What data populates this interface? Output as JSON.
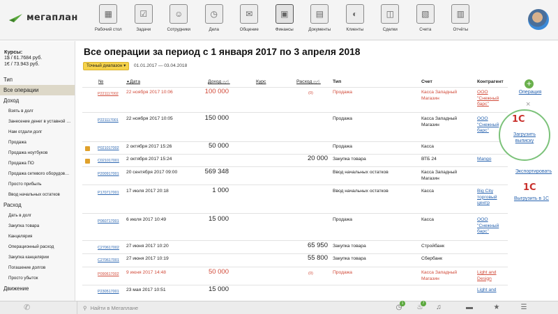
{
  "app": {
    "name": "мегаплан"
  },
  "nav": [
    {
      "label": "Рабочий стол",
      "icon": "desktop-icon"
    },
    {
      "label": "Задачи",
      "icon": "tasks-icon"
    },
    {
      "label": "Сотрудники",
      "icon": "employees-icon"
    },
    {
      "label": "Дела",
      "icon": "clock-icon"
    },
    {
      "label": "Общение",
      "icon": "chat-icon"
    },
    {
      "label": "Финансы",
      "icon": "safe-icon",
      "active": true
    },
    {
      "label": "Документы",
      "icon": "folder-icon"
    },
    {
      "label": "Клиенты",
      "icon": "clients-icon"
    },
    {
      "label": "Сделки",
      "icon": "briefcase-icon"
    },
    {
      "label": "Счета",
      "icon": "invoice-icon"
    },
    {
      "label": "Отчёты",
      "icon": "reports-icon"
    }
  ],
  "rates": {
    "title": "Курсы:",
    "usd": "1$ / 61.7684 руб.",
    "eur": "1€ / 73.943 руб."
  },
  "sidebar": {
    "type_head": "Тип",
    "all": "Все операции",
    "income_head": "Доход",
    "income": [
      "Взять в долг",
      "Занесение денег в уставной …",
      "Нам отдали долг",
      "Продажа",
      "Продажа ноутбуков",
      "Продажа ПО",
      "Продажа сетевого оборудов…",
      "Просто прибыль",
      "Ввод начальных остатков"
    ],
    "expense_head": "Расход",
    "expense": [
      "Дать в долг",
      "Закупка товара",
      "Канцелярия",
      "Операционный расход",
      "Закупка канцелярии",
      "Погашение долгов",
      "Просто убыток"
    ],
    "move_head": "Движение"
  },
  "main": {
    "title": "Все операции за период с 1 января 2017 по 3 апреля 2018",
    "range_label": "Точный диапазон",
    "range_value": "01.01.2017 — 03.04.2018"
  },
  "columns": {
    "num": "№",
    "date": "Дата",
    "income": "Доход",
    "unit1": "руб.",
    "rate": "Курс",
    "expense": "Расход",
    "unit2": "руб.",
    "type": "Тип",
    "account": "Счет",
    "contractor": "Контрагент"
  },
  "rows": [
    {
      "code": "Р221117002",
      "date": "22 ноября 2017 10:06",
      "income": "100 000",
      "expense": "(0)",
      "type": "Продажа",
      "account": "Касса Западный Магазин",
      "contractor": "ООО \"Снежный барс\"",
      "red": true
    },
    {
      "code": "Р221117001",
      "date": "22 ноября 2017 10:05",
      "income": "150 000",
      "expense": "",
      "type": "Продажа",
      "account": "Касса Западный Магазин",
      "contractor": "ООО \"Снежный барс\"",
      "red": false
    },
    {
      "code": "Р021017002",
      "date": "2 октября 2017 15:26",
      "income": "50 000",
      "expense": "",
      "type": "Продажа",
      "account": "Касса",
      "contractor": "",
      "red": false,
      "warn": true
    },
    {
      "code": "С021017001",
      "date": "2 октября 2017 15:24",
      "income": "",
      "expense": "20 000",
      "type": "Закупка товара",
      "account": "ВТБ 24",
      "contractor": "Mango",
      "red": false,
      "warn": true
    },
    {
      "code": "Р200917001",
      "date": "20 сентября 2017 09:00",
      "income": "569 348",
      "expense": "",
      "type": "Ввод начальных остатков",
      "account": "Касса Западный Магазин",
      "contractor": "",
      "red": false
    },
    {
      "code": "Р170717001",
      "date": "17 июля 2017 20:18",
      "income": "1 000",
      "expense": "",
      "type": "Ввод начальных остатков",
      "account": "Касса",
      "contractor": "Big City торговый центр",
      "red": false
    },
    {
      "code": "Р060717001",
      "date": "6 июля 2017 10:49",
      "income": "15 000",
      "expense": "",
      "type": "Продажа",
      "account": "Касса",
      "contractor": "ООО \"Снежный барс\"",
      "red": false
    },
    {
      "code": "С270617002",
      "date": "27 июня 2017 10:20",
      "income": "",
      "expense": "65 950",
      "type": "Закупка товара",
      "account": "Стройбанк",
      "contractor": "",
      "red": false
    },
    {
      "code": "С270617001",
      "date": "27 июня 2017 10:19",
      "income": "",
      "expense": "55 800",
      "type": "Закупка товара",
      "account": "Сбербанк",
      "contractor": "",
      "red": false
    },
    {
      "code": "Р090617002",
      "date": "9 июня 2017 14:48",
      "income": "50 000",
      "expense": "(0)",
      "type": "Продажа",
      "account": "Касса Западный Магазин",
      "contractor": "Light and Design",
      "red": true
    },
    {
      "code": "Р230517001",
      "date": "23 мая 2017 10:51",
      "income": "15 000",
      "expense": "",
      "type": "",
      "account": "",
      "contractor": "Light and",
      "red": false
    }
  ],
  "actions": {
    "operation": "Операция",
    "upload": "Загрузить выписку",
    "export": "Экспортировать",
    "upload1c": "Выгрузить в 1С",
    "brand_1c": "1С"
  },
  "bottom": {
    "search_placeholder": "Найти в Мегаплане",
    "badge1": "1",
    "badge2": "7"
  },
  "colors": {
    "accent": "#f5d24a",
    "link": "#2a65b0",
    "red": "#d14a39",
    "green": "#6ab04c"
  }
}
